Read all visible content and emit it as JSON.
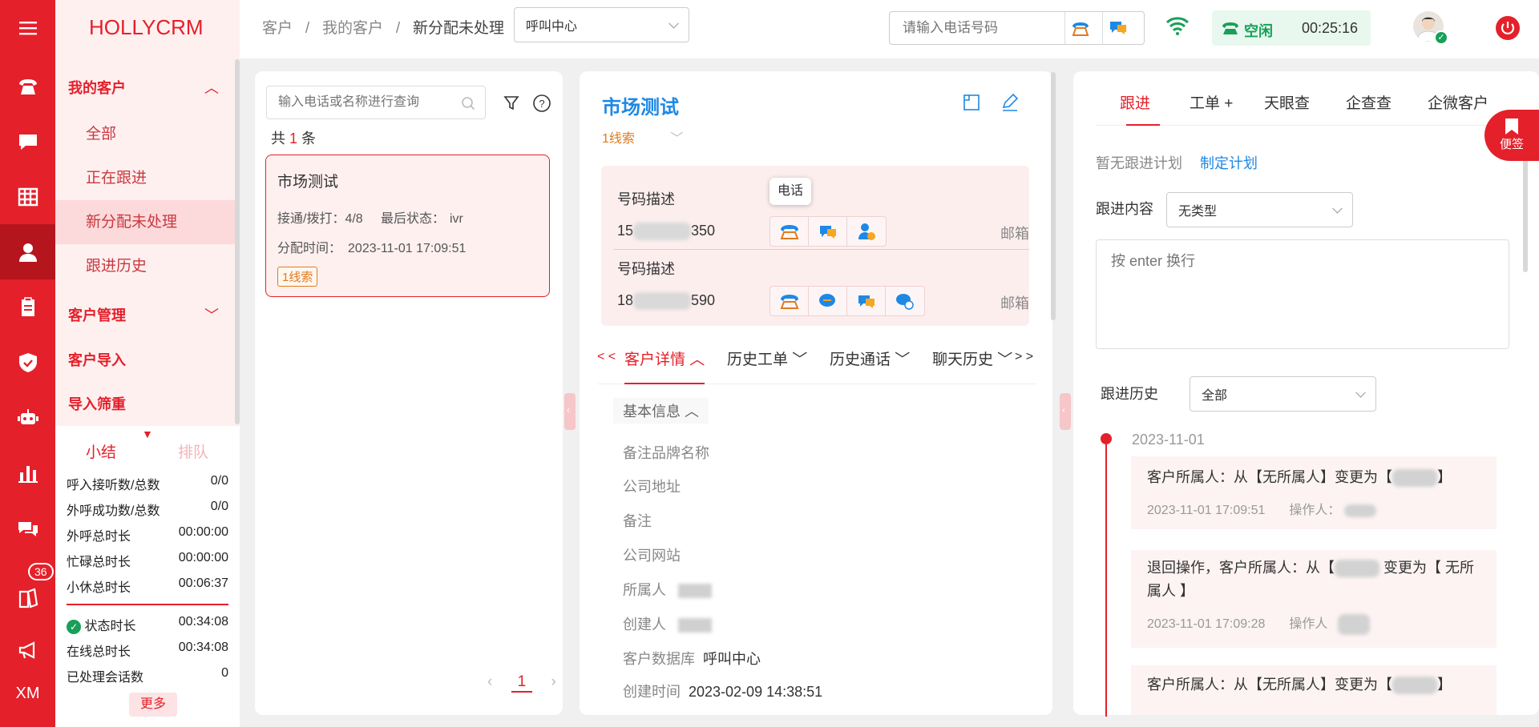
{
  "brand": "HOLLYCRM",
  "rail": {
    "badge": "36",
    "xm": "XM"
  },
  "nav": {
    "group1": "我的客户",
    "items": [
      "全部",
      "正在跟进",
      "新分配未处理",
      "跟进历史"
    ],
    "group2": "客户管理",
    "group3": "客户导入",
    "group4": "导入筛重"
  },
  "summary": {
    "tab_active": "小结",
    "tab_inactive": "排队",
    "stats": [
      {
        "label": "呼入接听数/总数",
        "value": "0/0"
      },
      {
        "label": "外呼成功数/总数",
        "value": "0/0"
      },
      {
        "label": "外呼总时长",
        "value": "00:00:00"
      },
      {
        "label": "忙碌总时长",
        "value": "00:00:00"
      },
      {
        "label": "小休总时长",
        "value": "00:06:37"
      }
    ],
    "stats2": [
      {
        "label": "状态时长",
        "value": "00:34:08"
      },
      {
        "label": "在线总时长",
        "value": "00:34:08"
      },
      {
        "label": "已处理会话数",
        "value": "0"
      }
    ],
    "more": "更多"
  },
  "topbar": {
    "crumb1": "客户",
    "crumb2": "我的客户",
    "crumb3": "新分配未处理",
    "sep": "/",
    "center_select": "呼叫中心",
    "phone_placeholder": "请输入电话号码",
    "status": "空闲",
    "timer": "00:25:16"
  },
  "list": {
    "search_placeholder": "输入电话或名称进行查询",
    "count_prefix": "共",
    "count": "1",
    "count_suffix": "条",
    "card": {
      "title": "市场测试",
      "calls_label": "接通/拨打：",
      "calls": "4/8",
      "last_status_label": "最后状态：",
      "last_status": "ivr",
      "assign_label": "分配时间：",
      "assign_time": "2023-11-01 17:09:51",
      "tag": "1线索"
    },
    "page": "1"
  },
  "detail": {
    "name": "市场测试",
    "lead": "1线索",
    "phones": [
      {
        "label": "号码描述",
        "prefix": "15",
        "suffix": "350",
        "mail": "邮箱"
      },
      {
        "label": "号码描述",
        "prefix": "18",
        "suffix": "590",
        "mail": "邮箱"
      }
    ],
    "tooltip": "电话",
    "tabs": [
      "客户详情",
      "历史工单",
      "历史通话",
      "聊天历史"
    ],
    "tab_prev": "< <",
    "tab_next": "> >",
    "section": "基本信息",
    "fields": [
      {
        "label": "备注品牌名称",
        "value": ""
      },
      {
        "label": "公司地址",
        "value": ""
      },
      {
        "label": "备注",
        "value": ""
      },
      {
        "label": "公司网站",
        "value": ""
      },
      {
        "label": "所属人",
        "value": ""
      },
      {
        "label": "创建人",
        "value": ""
      },
      {
        "label": "客户数据库",
        "value": "呼叫中心"
      },
      {
        "label": "创建时间",
        "value": "2023-02-09 14:38:51"
      }
    ]
  },
  "follow": {
    "tabs": [
      "跟进",
      "工单 +",
      "天眼查",
      "企查查",
      "企微客户"
    ],
    "bookmark": "便签",
    "no_plan": "暂无跟进计划",
    "make_plan": "制定计划",
    "content_label": "跟进内容",
    "content_type": "无类型",
    "textarea_placeholder": "按 enter 换行",
    "history_label": "跟进历史",
    "history_filter": "全部",
    "date": "2023-11-01",
    "entries": [
      {
        "text_a": "客户所属人：从【无所属人】变更为【",
        "text_b": "】",
        "time": "2023-11-01 17:09:51",
        "operator_label": "操作人："
      },
      {
        "text_a": "退回操作，客户所属人：从【",
        "text_b": "变更为【 无所属人 】",
        "time": "2023-11-01 17:09:28",
        "operator_label": "操作人"
      },
      {
        "text_a": "客户所属人：从【无所属人】变更为【",
        "text_b": "】",
        "time": "",
        "operator_label": ""
      }
    ]
  },
  "colors": {
    "brand_red": "#e4202a",
    "link_blue": "#1e88e5",
    "lead_orange": "#e07a1f",
    "idle_green": "#18a058"
  }
}
